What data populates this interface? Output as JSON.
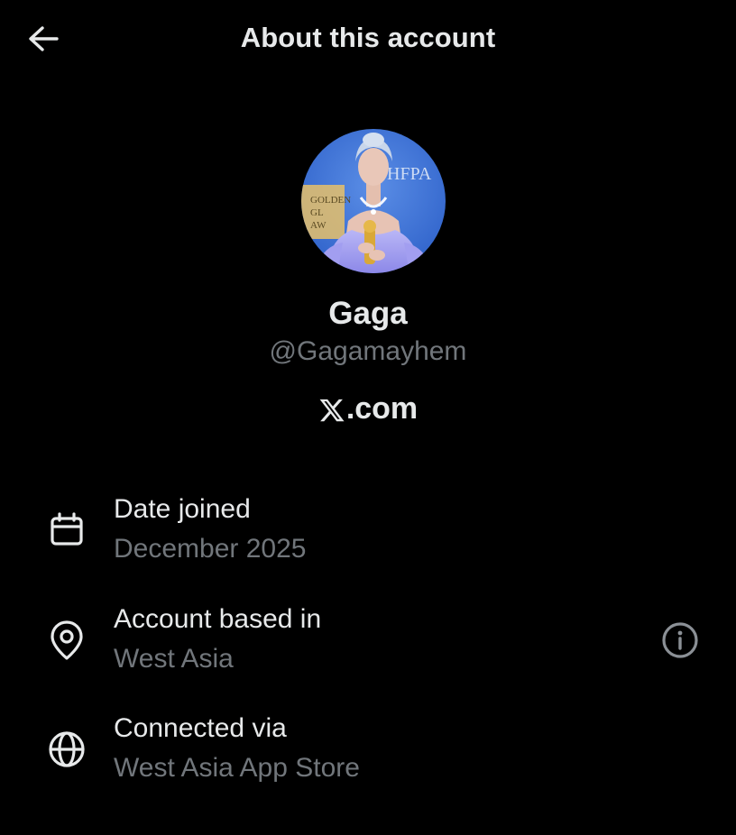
{
  "header": {
    "title": "About this account",
    "back_icon": "arrow-left-icon"
  },
  "profile": {
    "avatar_description": "avatar",
    "display_name": "Gaga",
    "handle": "@Gagamayhem",
    "brand_icon": "x-logo-icon",
    "brand_suffix": ".com",
    "avatar_text_1": "HFPA",
    "avatar_text_2": "GOLDEN GLOBE AWARDS"
  },
  "details": [
    {
      "icon": "calendar-icon",
      "label": "Date joined",
      "value": "December 2025"
    },
    {
      "icon": "location-pin-icon",
      "label": "Account based in",
      "value": "West Asia",
      "action_icon": "info-icon"
    },
    {
      "icon": "globe-icon",
      "label": "Connected via",
      "value": "West Asia App Store"
    }
  ],
  "colors": {
    "background": "#000000",
    "primary_text": "#e7e9ea",
    "secondary_text": "#71767b",
    "avatar_bg": "#3d6fd1",
    "avatar_dress": "#a6a3f2"
  }
}
